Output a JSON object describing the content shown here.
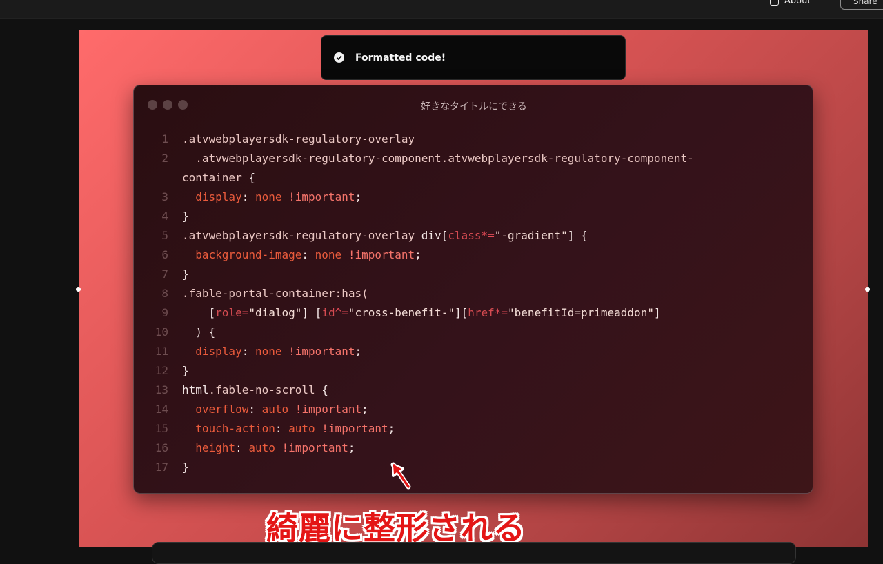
{
  "topbar": {
    "about_label": "About",
    "share_label": "Share"
  },
  "toast": {
    "message": "Formatted code!",
    "icon": "check-circle-icon"
  },
  "window": {
    "title": "好きなタイトルにできる",
    "control_dots": [
      "close",
      "minimize",
      "maximize"
    ]
  },
  "code": {
    "line_numbers": [
      "1",
      "2",
      "3",
      "4",
      "5",
      "6",
      "7",
      "8",
      "9",
      "10",
      "11",
      "12",
      "13",
      "14",
      "15",
      "16",
      "17"
    ],
    "lines": [
      [
        {
          "c": "sel",
          "t": ".atvwebplayersdk-regulatory-overlay"
        }
      ],
      [
        {
          "c": "sel",
          "t": "  .atvwebplayersdk-regulatory-component.atvwebplayersdk-regulatory-component-"
        }
      ],
      [
        {
          "c": "sel",
          "t": "container"
        },
        {
          "c": "punc",
          "t": " {"
        }
      ],
      [
        {
          "c": "prop",
          "t": "  display"
        },
        {
          "c": "punc",
          "t": ": "
        },
        {
          "c": "val",
          "t": "none"
        },
        {
          "c": "imp",
          "t": " !important"
        },
        {
          "c": "punc",
          "t": ";"
        }
      ],
      [
        {
          "c": "punc",
          "t": "}"
        }
      ],
      [
        {
          "c": "sel",
          "t": ".atvwebplayersdk-regulatory-overlay "
        },
        {
          "c": "punc",
          "t": "div["
        },
        {
          "c": "attr",
          "t": "class"
        },
        {
          "c": "op",
          "t": "*="
        },
        {
          "c": "str",
          "t": "\"-gradient\""
        },
        {
          "c": "punc",
          "t": "] {"
        }
      ],
      [
        {
          "c": "prop",
          "t": "  background-image"
        },
        {
          "c": "punc",
          "t": ": "
        },
        {
          "c": "val",
          "t": "none"
        },
        {
          "c": "imp",
          "t": " !important"
        },
        {
          "c": "punc",
          "t": ";"
        }
      ],
      [
        {
          "c": "punc",
          "t": "}"
        }
      ],
      [
        {
          "c": "sel",
          "t": ".fable-portal-container:has("
        }
      ],
      [
        {
          "c": "punc",
          "t": "    ["
        },
        {
          "c": "attr",
          "t": "role"
        },
        {
          "c": "op",
          "t": "="
        },
        {
          "c": "str",
          "t": "\"dialog\""
        },
        {
          "c": "punc",
          "t": "] ["
        },
        {
          "c": "attr",
          "t": "id"
        },
        {
          "c": "op",
          "t": "^="
        },
        {
          "c": "str",
          "t": "\"cross-benefit-\""
        },
        {
          "c": "punc",
          "t": "]["
        },
        {
          "c": "attr",
          "t": "href"
        },
        {
          "c": "op",
          "t": "*="
        },
        {
          "c": "str",
          "t": "\"benefitId=primeaddon\""
        },
        {
          "c": "punc",
          "t": "]"
        }
      ],
      [
        {
          "c": "punc",
          "t": "  ) {"
        }
      ],
      [
        {
          "c": "prop",
          "t": "  display"
        },
        {
          "c": "punc",
          "t": ": "
        },
        {
          "c": "val",
          "t": "none"
        },
        {
          "c": "imp",
          "t": " !important"
        },
        {
          "c": "punc",
          "t": ";"
        }
      ],
      [
        {
          "c": "punc",
          "t": "}"
        }
      ],
      [
        {
          "c": "punc",
          "t": "html"
        },
        {
          "c": "sel",
          "t": ".fable-no-scroll"
        },
        {
          "c": "punc",
          "t": " {"
        }
      ],
      [
        {
          "c": "prop",
          "t": "  overflow"
        },
        {
          "c": "punc",
          "t": ": "
        },
        {
          "c": "val",
          "t": "auto"
        },
        {
          "c": "imp",
          "t": " !important"
        },
        {
          "c": "punc",
          "t": ";"
        }
      ],
      [
        {
          "c": "prop",
          "t": "  touch-action"
        },
        {
          "c": "punc",
          "t": ": "
        },
        {
          "c": "val",
          "t": "auto"
        },
        {
          "c": "imp",
          "t": " !important"
        },
        {
          "c": "punc",
          "t": ";"
        }
      ],
      [
        {
          "c": "prop",
          "t": "  height"
        },
        {
          "c": "punc",
          "t": ": "
        },
        {
          "c": "val",
          "t": "auto"
        },
        {
          "c": "imp",
          "t": " !important"
        },
        {
          "c": "punc",
          "t": ";"
        }
      ],
      [
        {
          "c": "punc",
          "t": "}"
        }
      ]
    ]
  },
  "annotation": {
    "caption": "綺麗に整形される",
    "arrow": "red-arrow-icon"
  },
  "colors": {
    "caption": "#e41616",
    "canvas_start": "#ff6b6b",
    "canvas_end": "#8e3434"
  }
}
